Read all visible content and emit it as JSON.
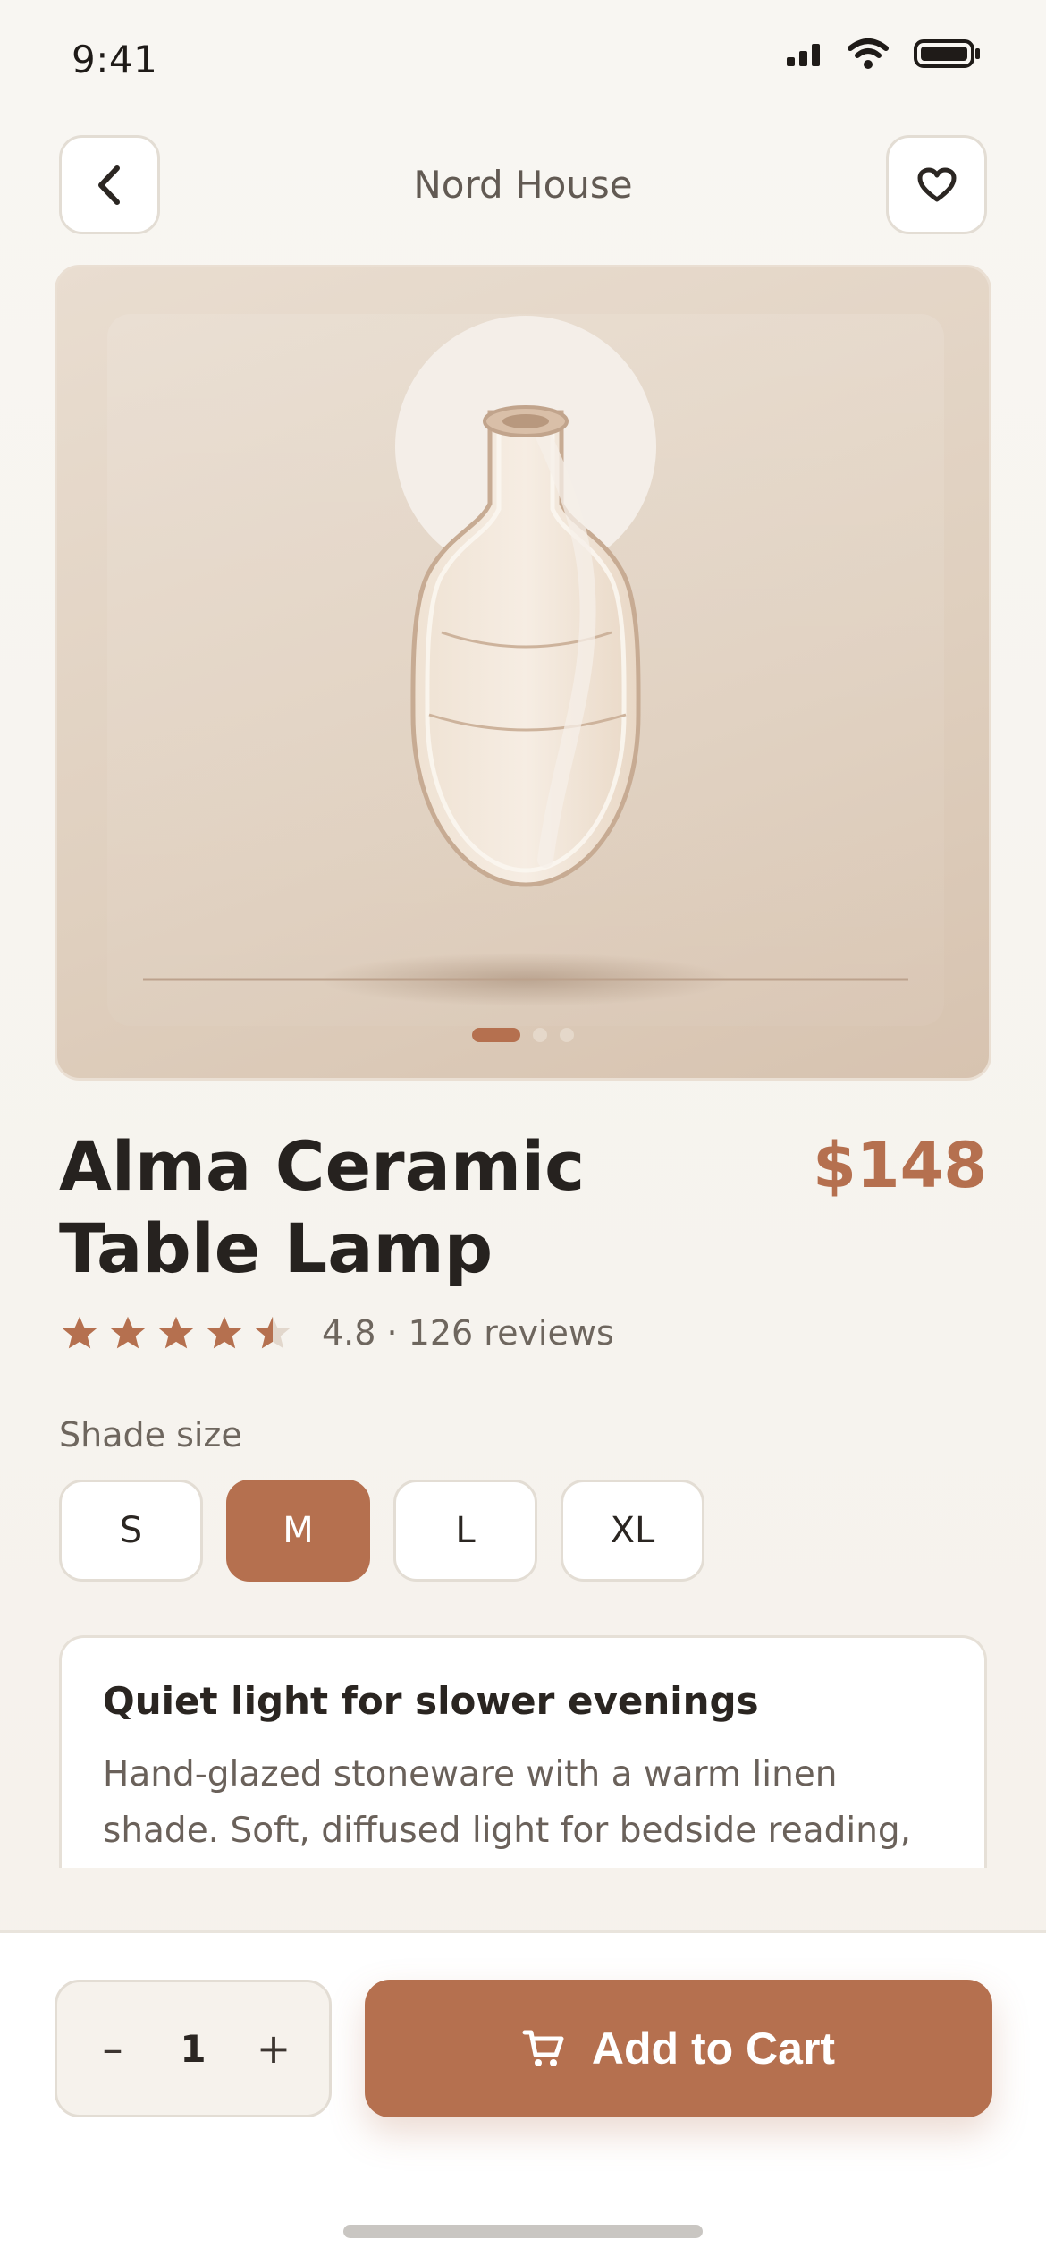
{
  "status_bar": {
    "time": "9:41"
  },
  "header": {
    "title": "Nord House",
    "back_icon": "chevron-left-icon",
    "favorite_icon": "heart-icon"
  },
  "carousel": {
    "total": 3,
    "active": 1
  },
  "product": {
    "name_line1": "Alma Ceramic",
    "name_line2": "Table Lamp",
    "price": "$148",
    "rating": {
      "stars": 4.5,
      "text": "4.8 · 126 reviews"
    }
  },
  "shade": {
    "label": "Shade size",
    "options": [
      "S",
      "M",
      "L",
      "XL"
    ],
    "selected": "M"
  },
  "description": {
    "title": "Quiet light for slower evenings",
    "body": "Hand-glazed stoneware with a warm linen shade. Soft, diffused light for bedside reading, hallway consoles, or a calm corner of the living room."
  },
  "cart": {
    "quantity": "1",
    "minus": "–",
    "plus": "+",
    "button_label": "Add to Cart",
    "button_icon": "cart-icon"
  },
  "colors": {
    "accent": "#b5704f",
    "background": "#f7f4ef",
    "text": "#26221f"
  }
}
